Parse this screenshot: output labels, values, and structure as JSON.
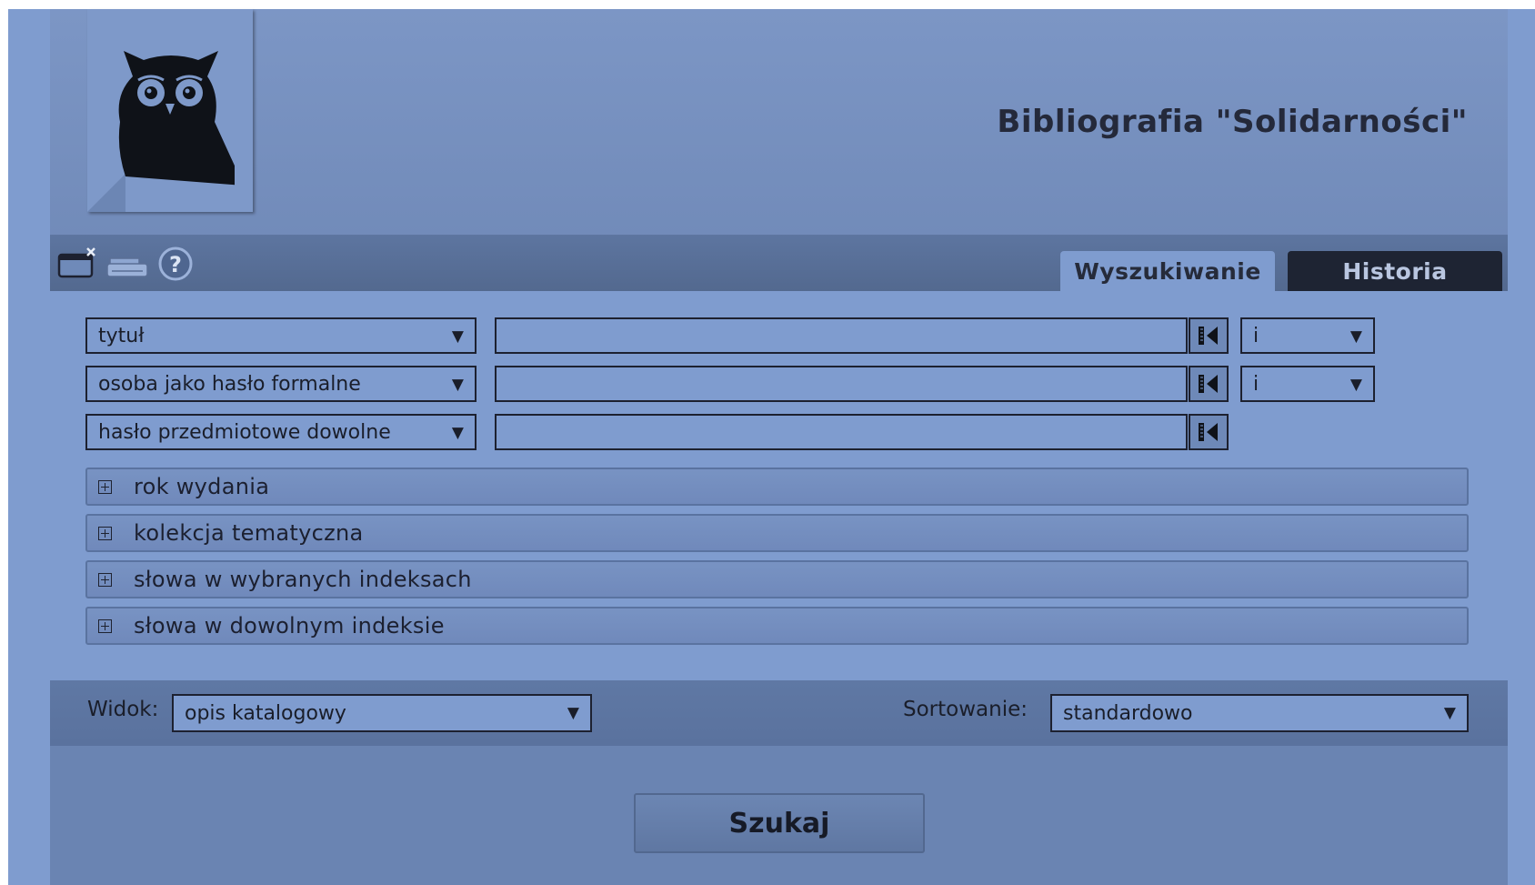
{
  "header": {
    "title": "Bibliografia \"Solidarności\"",
    "logo_icon": "owl-logo-icon"
  },
  "toolbar": {
    "icons": [
      "new-window-icon",
      "print-icon",
      "help-icon"
    ],
    "help_glyph": "?"
  },
  "tabs": [
    {
      "label": "Wyszukiwanie",
      "active": true
    },
    {
      "label": "Historia",
      "active": false
    }
  ],
  "search_rows": [
    {
      "field": "tytuł",
      "value": "",
      "operator": "i"
    },
    {
      "field": "osoba jako hasło formalne",
      "value": "",
      "operator": "i"
    },
    {
      "field": "hasło przedmiotowe dowolne",
      "value": ""
    }
  ],
  "accordions": [
    {
      "label": "rok wydania"
    },
    {
      "label": "kolekcja tematyczna"
    },
    {
      "label": "słowa w wybranych indeksach"
    },
    {
      "label": "słowa w dowolnym indeksie"
    }
  ],
  "options": {
    "view_label": "Widok:",
    "view_value": "opis katalogowy",
    "sort_label": "Sortowanie:",
    "sort_value": "standardowo"
  },
  "search_button": {
    "label": "Szukaj"
  },
  "colors": {
    "background": "#7f9ccf",
    "panel": "#6c85b3",
    "tab_inactive": "#1e2433",
    "text": "#1a1e2a"
  }
}
